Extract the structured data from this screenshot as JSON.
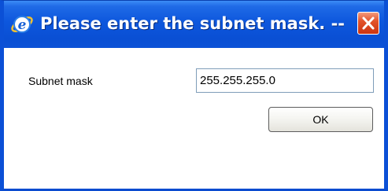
{
  "window": {
    "title": "Please enter the subnet mask. --...",
    "icon": "internet-explorer-icon",
    "close_icon": "close-icon"
  },
  "form": {
    "subnet_label": "Subnet mask",
    "subnet_value": "255.255.255.0",
    "ok_label": "OK"
  },
  "colors": {
    "titlebar": "#0a4fd4",
    "close_button": "#e2532b",
    "input_border": "#7f9db9"
  }
}
